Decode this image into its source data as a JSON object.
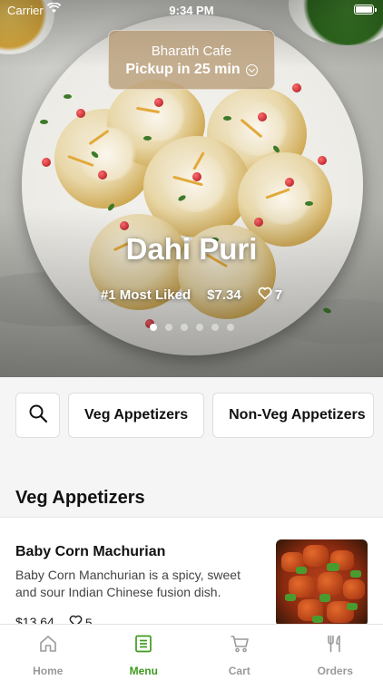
{
  "status_bar": {
    "carrier": "Carrier",
    "time": "9:34 PM"
  },
  "pickup": {
    "cafe": "Bharath Cafe",
    "time": "Pickup in 25 min"
  },
  "hero": {
    "dish": "Dahi Puri",
    "rank": "#1 Most Liked",
    "price": "$7.34",
    "likes": "7",
    "carousel_total": 6,
    "carousel_active": 1
  },
  "categories": [
    "Veg Appetizers",
    "Non-Veg Appetizers"
  ],
  "section": {
    "title": "Veg Appetizers"
  },
  "items": [
    {
      "name": "Baby Corn Machurian",
      "description": "Baby Corn Manchurian is a spicy, sweet and sour Indian Chinese fusion dish.",
      "price": "$13.64",
      "likes": "5"
    }
  ],
  "tabs": [
    {
      "label": "Home",
      "icon": "home-icon",
      "active": false
    },
    {
      "label": "Menu",
      "icon": "menu-icon",
      "active": true
    },
    {
      "label": "Cart",
      "icon": "cart-icon",
      "active": false
    },
    {
      "label": "Orders",
      "icon": "orders-icon",
      "active": false
    }
  ],
  "colors": {
    "accent": "#3f9b1f",
    "inactive": "#9a9a9a",
    "background": "#f5f5f5"
  }
}
